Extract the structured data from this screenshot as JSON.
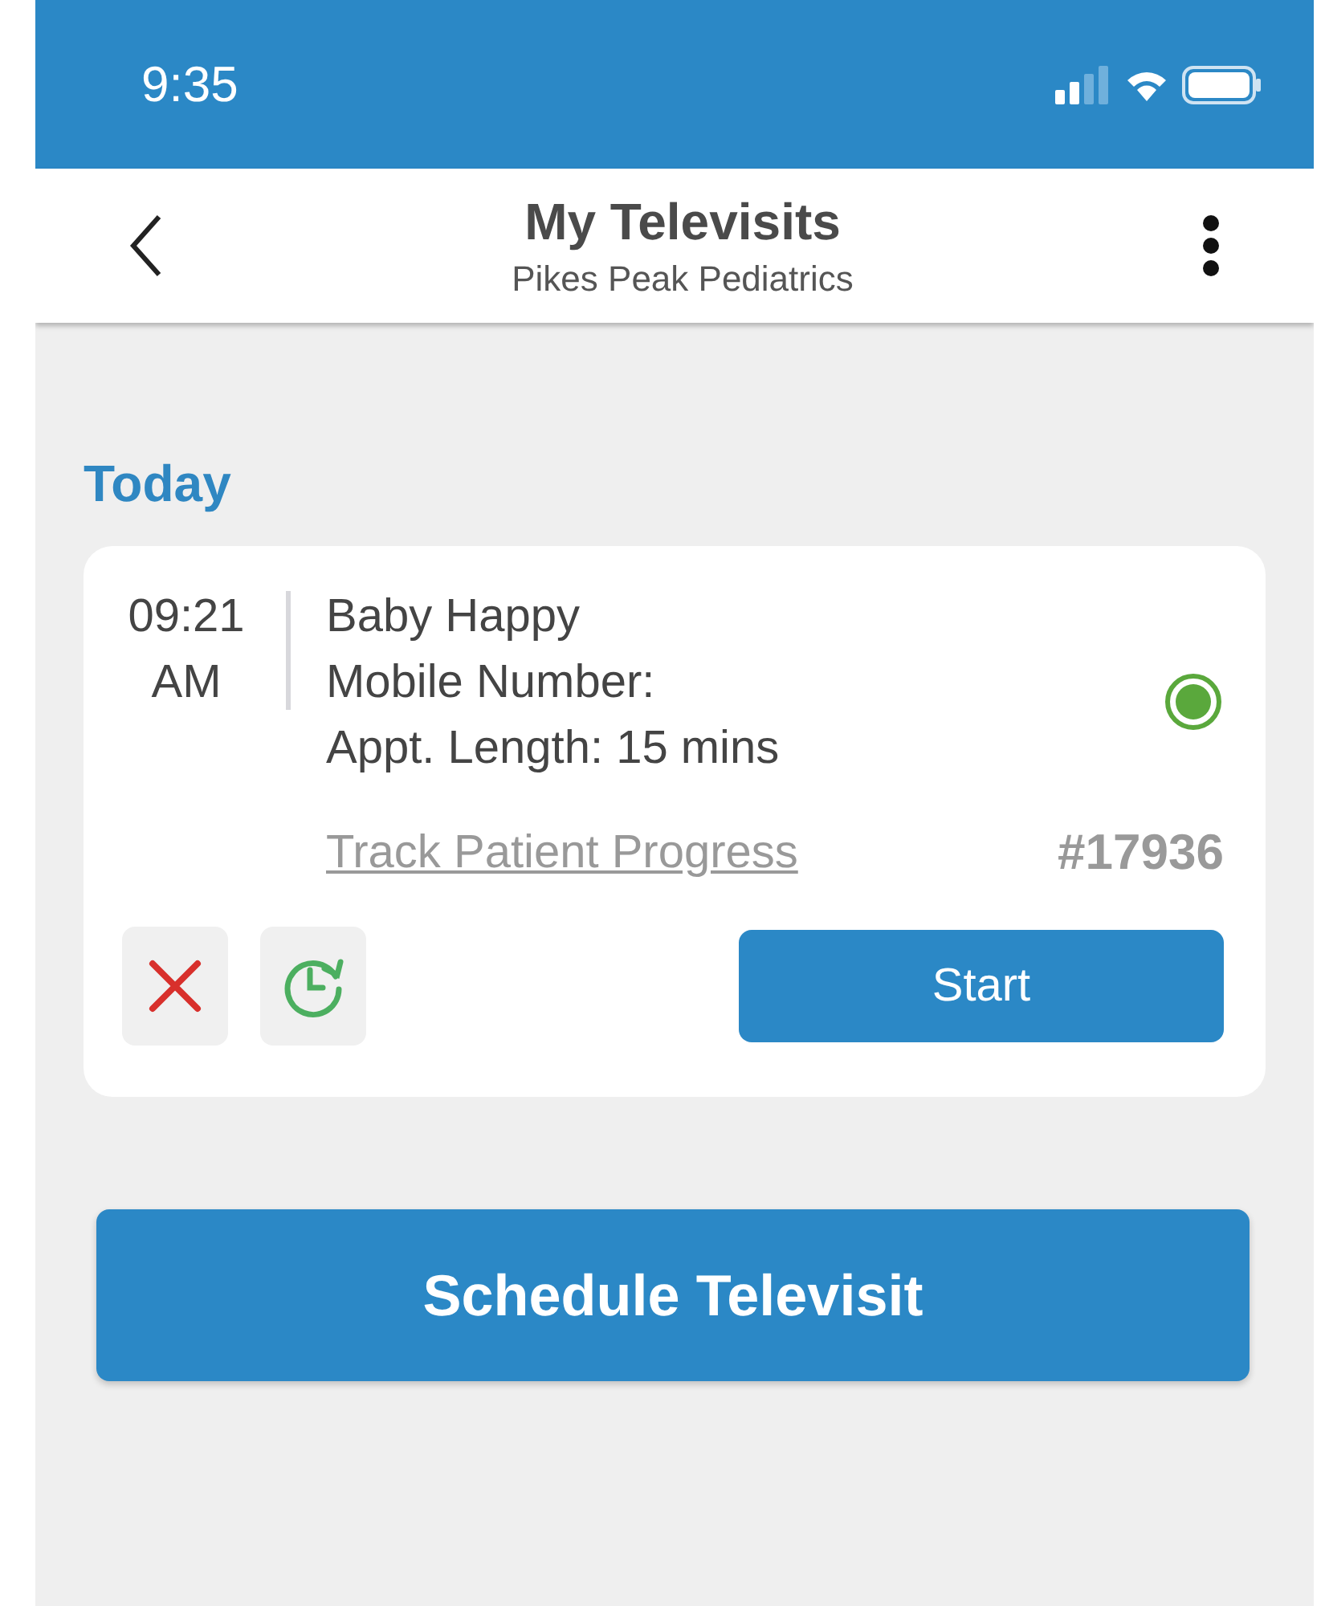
{
  "status_bar": {
    "time": "9:35"
  },
  "header": {
    "title": "My Televisits",
    "subtitle": "Pikes Peak Pediatrics"
  },
  "section": {
    "title": "Today"
  },
  "visits": [
    {
      "time": "09:21",
      "meridiem": "AM",
      "patient": "Baby Happy",
      "mobile": "Mobile Number:",
      "length": "Appt. Length: 15 mins",
      "online": true,
      "link": "Track Patient Progress",
      "number": "#17936",
      "start_label": "Start"
    }
  ],
  "schedule_button": "Schedule Televisit"
}
